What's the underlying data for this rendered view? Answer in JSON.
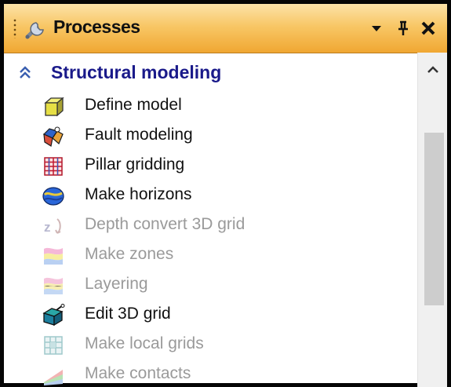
{
  "panel": {
    "title": "Processes",
    "title_icon": "wrench-icon",
    "controls": [
      "dropdown-arrow-icon",
      "pin-icon",
      "close-icon"
    ]
  },
  "group": {
    "title": "Structural modeling",
    "expanded": true,
    "icon": "double-chevron-up-icon"
  },
  "items": [
    {
      "label": "Define model",
      "icon": "cube-icon",
      "enabled": true
    },
    {
      "label": "Fault modeling",
      "icon": "fault-modeling-icon",
      "enabled": true
    },
    {
      "label": "Pillar gridding",
      "icon": "pillar-grid-icon",
      "enabled": true
    },
    {
      "label": "Make horizons",
      "icon": "horizons-icon",
      "enabled": true
    },
    {
      "label": "Depth convert 3D grid",
      "icon": "depth-convert-icon",
      "enabled": false
    },
    {
      "label": "Make zones",
      "icon": "zones-icon",
      "enabled": false
    },
    {
      "label": "Layering",
      "icon": "layering-icon",
      "enabled": false
    },
    {
      "label": "Edit 3D grid",
      "icon": "edit-grid-icon",
      "enabled": true
    },
    {
      "label": "Make local grids",
      "icon": "local-grid-icon",
      "enabled": false
    },
    {
      "label": "Make contacts",
      "icon": "contacts-icon",
      "enabled": false
    }
  ],
  "colors": {
    "titlebar_top": "#fce3a8",
    "titlebar_bottom": "#f0a732",
    "group_title": "#1a1a8a",
    "disabled_text": "#9a9a9a"
  }
}
